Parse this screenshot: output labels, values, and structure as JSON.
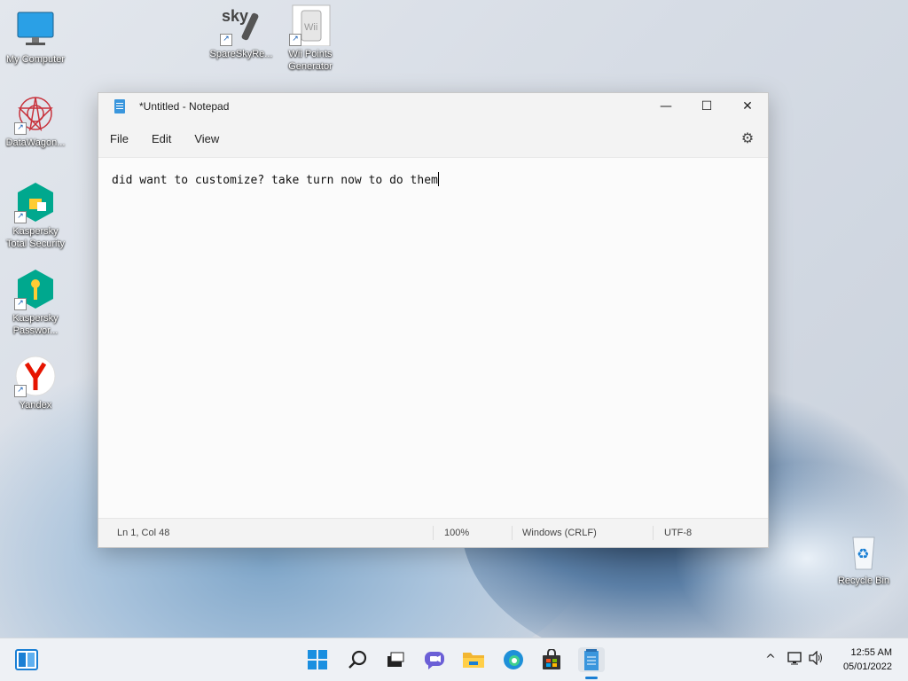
{
  "desktop": {
    "icons": [
      {
        "label": "My Computer"
      },
      {
        "label": "SpareSkyRe..."
      },
      {
        "label": "Wii Points\nGenerator"
      },
      {
        "label": "DataWagon..."
      },
      {
        "label": "Kaspersky\nTotal Security"
      },
      {
        "label": "Kaspersky\nPasswor..."
      },
      {
        "label": "Yandex"
      },
      {
        "label": "Recycle Bin"
      }
    ],
    "sky_text": "sky",
    "wii_text": "Wii"
  },
  "notepad": {
    "title": "*Untitled - Notepad",
    "menu": [
      "File",
      "Edit",
      "View"
    ],
    "content": "did want to customize? take turn now to do them",
    "status": {
      "position": "Ln 1, Col 48",
      "zoom": "100%",
      "line_ending": "Windows (CRLF)",
      "encoding": "UTF-8"
    },
    "controls": {
      "minimize": "—",
      "maximize": "☐",
      "close": "✕"
    }
  },
  "taskbar": {
    "clock_time": "12:55 AM",
    "clock_date": "05/01/2022",
    "icons": [
      "widgets-icon",
      "start-icon",
      "search-icon",
      "task-view-icon",
      "chat-icon",
      "file-explorer-icon",
      "edge-icon",
      "store-icon",
      "notepad-icon"
    ]
  },
  "colors": {
    "accent": "#0078d4",
    "kaspersky": "#00a88e",
    "yandex": "#e61400",
    "datawagon": "#c8323c"
  }
}
